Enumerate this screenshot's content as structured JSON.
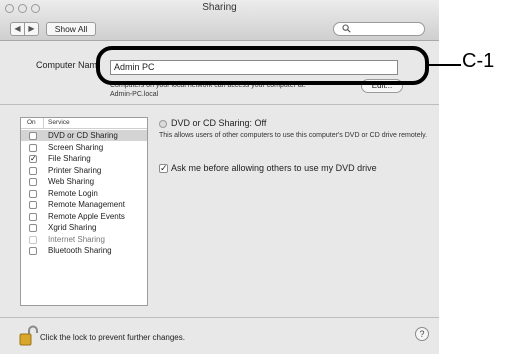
{
  "window": {
    "title": "Sharing",
    "show_all_label": "Show All",
    "back_icon": "◀",
    "forward_icon": "▶",
    "search_icon": "🔍"
  },
  "computer_name": {
    "label": "Computer Nam",
    "value": "Admin PC",
    "subtext_line1": "Computers on your local network can access your computer at:",
    "subtext_line2": "Admin-PC.local",
    "edit_label": "Edit..."
  },
  "callout": {
    "label": "C-1"
  },
  "services": {
    "col_on": "On",
    "col_service": "Service",
    "items": [
      {
        "name": "DVD or CD Sharing",
        "checked": false,
        "selected": true,
        "disabled": false,
        "check": ""
      },
      {
        "name": "Screen Sharing",
        "checked": false,
        "selected": false,
        "disabled": false,
        "check": ""
      },
      {
        "name": "File Sharing",
        "checked": true,
        "selected": false,
        "disabled": false,
        "check": "✓"
      },
      {
        "name": "Printer Sharing",
        "checked": false,
        "selected": false,
        "disabled": false,
        "check": ""
      },
      {
        "name": "Web Sharing",
        "checked": false,
        "selected": false,
        "disabled": false,
        "check": ""
      },
      {
        "name": "Remote Login",
        "checked": false,
        "selected": false,
        "disabled": false,
        "check": ""
      },
      {
        "name": "Remote Management",
        "checked": false,
        "selected": false,
        "disabled": false,
        "check": ""
      },
      {
        "name": "Remote Apple Events",
        "checked": false,
        "selected": false,
        "disabled": false,
        "check": ""
      },
      {
        "name": "Xgrid Sharing",
        "checked": false,
        "selected": false,
        "disabled": false,
        "check": ""
      },
      {
        "name": "Internet Sharing",
        "checked": false,
        "selected": false,
        "disabled": true,
        "check": ""
      },
      {
        "name": "Bluetooth Sharing",
        "checked": false,
        "selected": false,
        "disabled": false,
        "check": ""
      }
    ]
  },
  "detail": {
    "status": "DVD or CD Sharing: Off",
    "description": "This allows users of other computers to use this computer's DVD or CD drive remotely.",
    "option_label": "Ask me before allowing others to use my DVD drive",
    "option_check": "✓"
  },
  "footer": {
    "lock_text": "Click the lock to prevent further changes.",
    "help_label": "?"
  }
}
